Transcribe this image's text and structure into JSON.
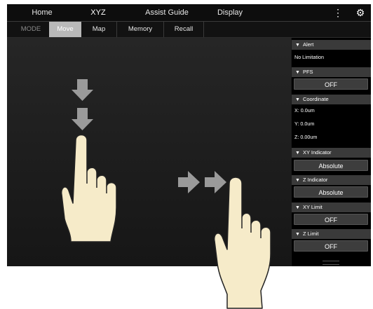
{
  "topbar": {
    "tabs": [
      {
        "label": "Home"
      },
      {
        "label": "XYZ"
      },
      {
        "label": "Assist Guide"
      },
      {
        "label": "Display"
      }
    ],
    "icons": [
      "more-vertical-icon",
      "gear-icon"
    ]
  },
  "subbar": {
    "mode_label": "MODE",
    "items": [
      {
        "label": "Move"
      },
      {
        "label": "Map"
      },
      {
        "label": "Memory"
      },
      {
        "label": "Recall"
      }
    ]
  },
  "panel": {
    "alert": {
      "header": "Alert",
      "value": "No Limitation"
    },
    "pfs": {
      "header": "PFS",
      "value": "OFF"
    },
    "coordinate": {
      "header": "Coordinate",
      "x": "X: 0.0um",
      "y": "Y: 0.0um",
      "z": "Z: 0.00um"
    },
    "xy_indicator": {
      "header": "XY Indicator",
      "value": "Absolute"
    },
    "z_indicator": {
      "header": "Z Indicator",
      "value": "Absolute"
    },
    "xy_limit": {
      "header": "XY Limit",
      "value": "OFF"
    },
    "z_limit": {
      "header": "Z Limit",
      "value": "OFF"
    }
  },
  "gestures": [
    "arrow-down-icon",
    "hand-swipe-down-icon",
    "arrow-right-icon",
    "hand-swipe-right-icon"
  ],
  "colors": {
    "accent_active": "#b9b9b9",
    "panel_header": "#3a3a3a",
    "background": "#1b1b1b",
    "hand_fill": "#f6ebc9"
  }
}
